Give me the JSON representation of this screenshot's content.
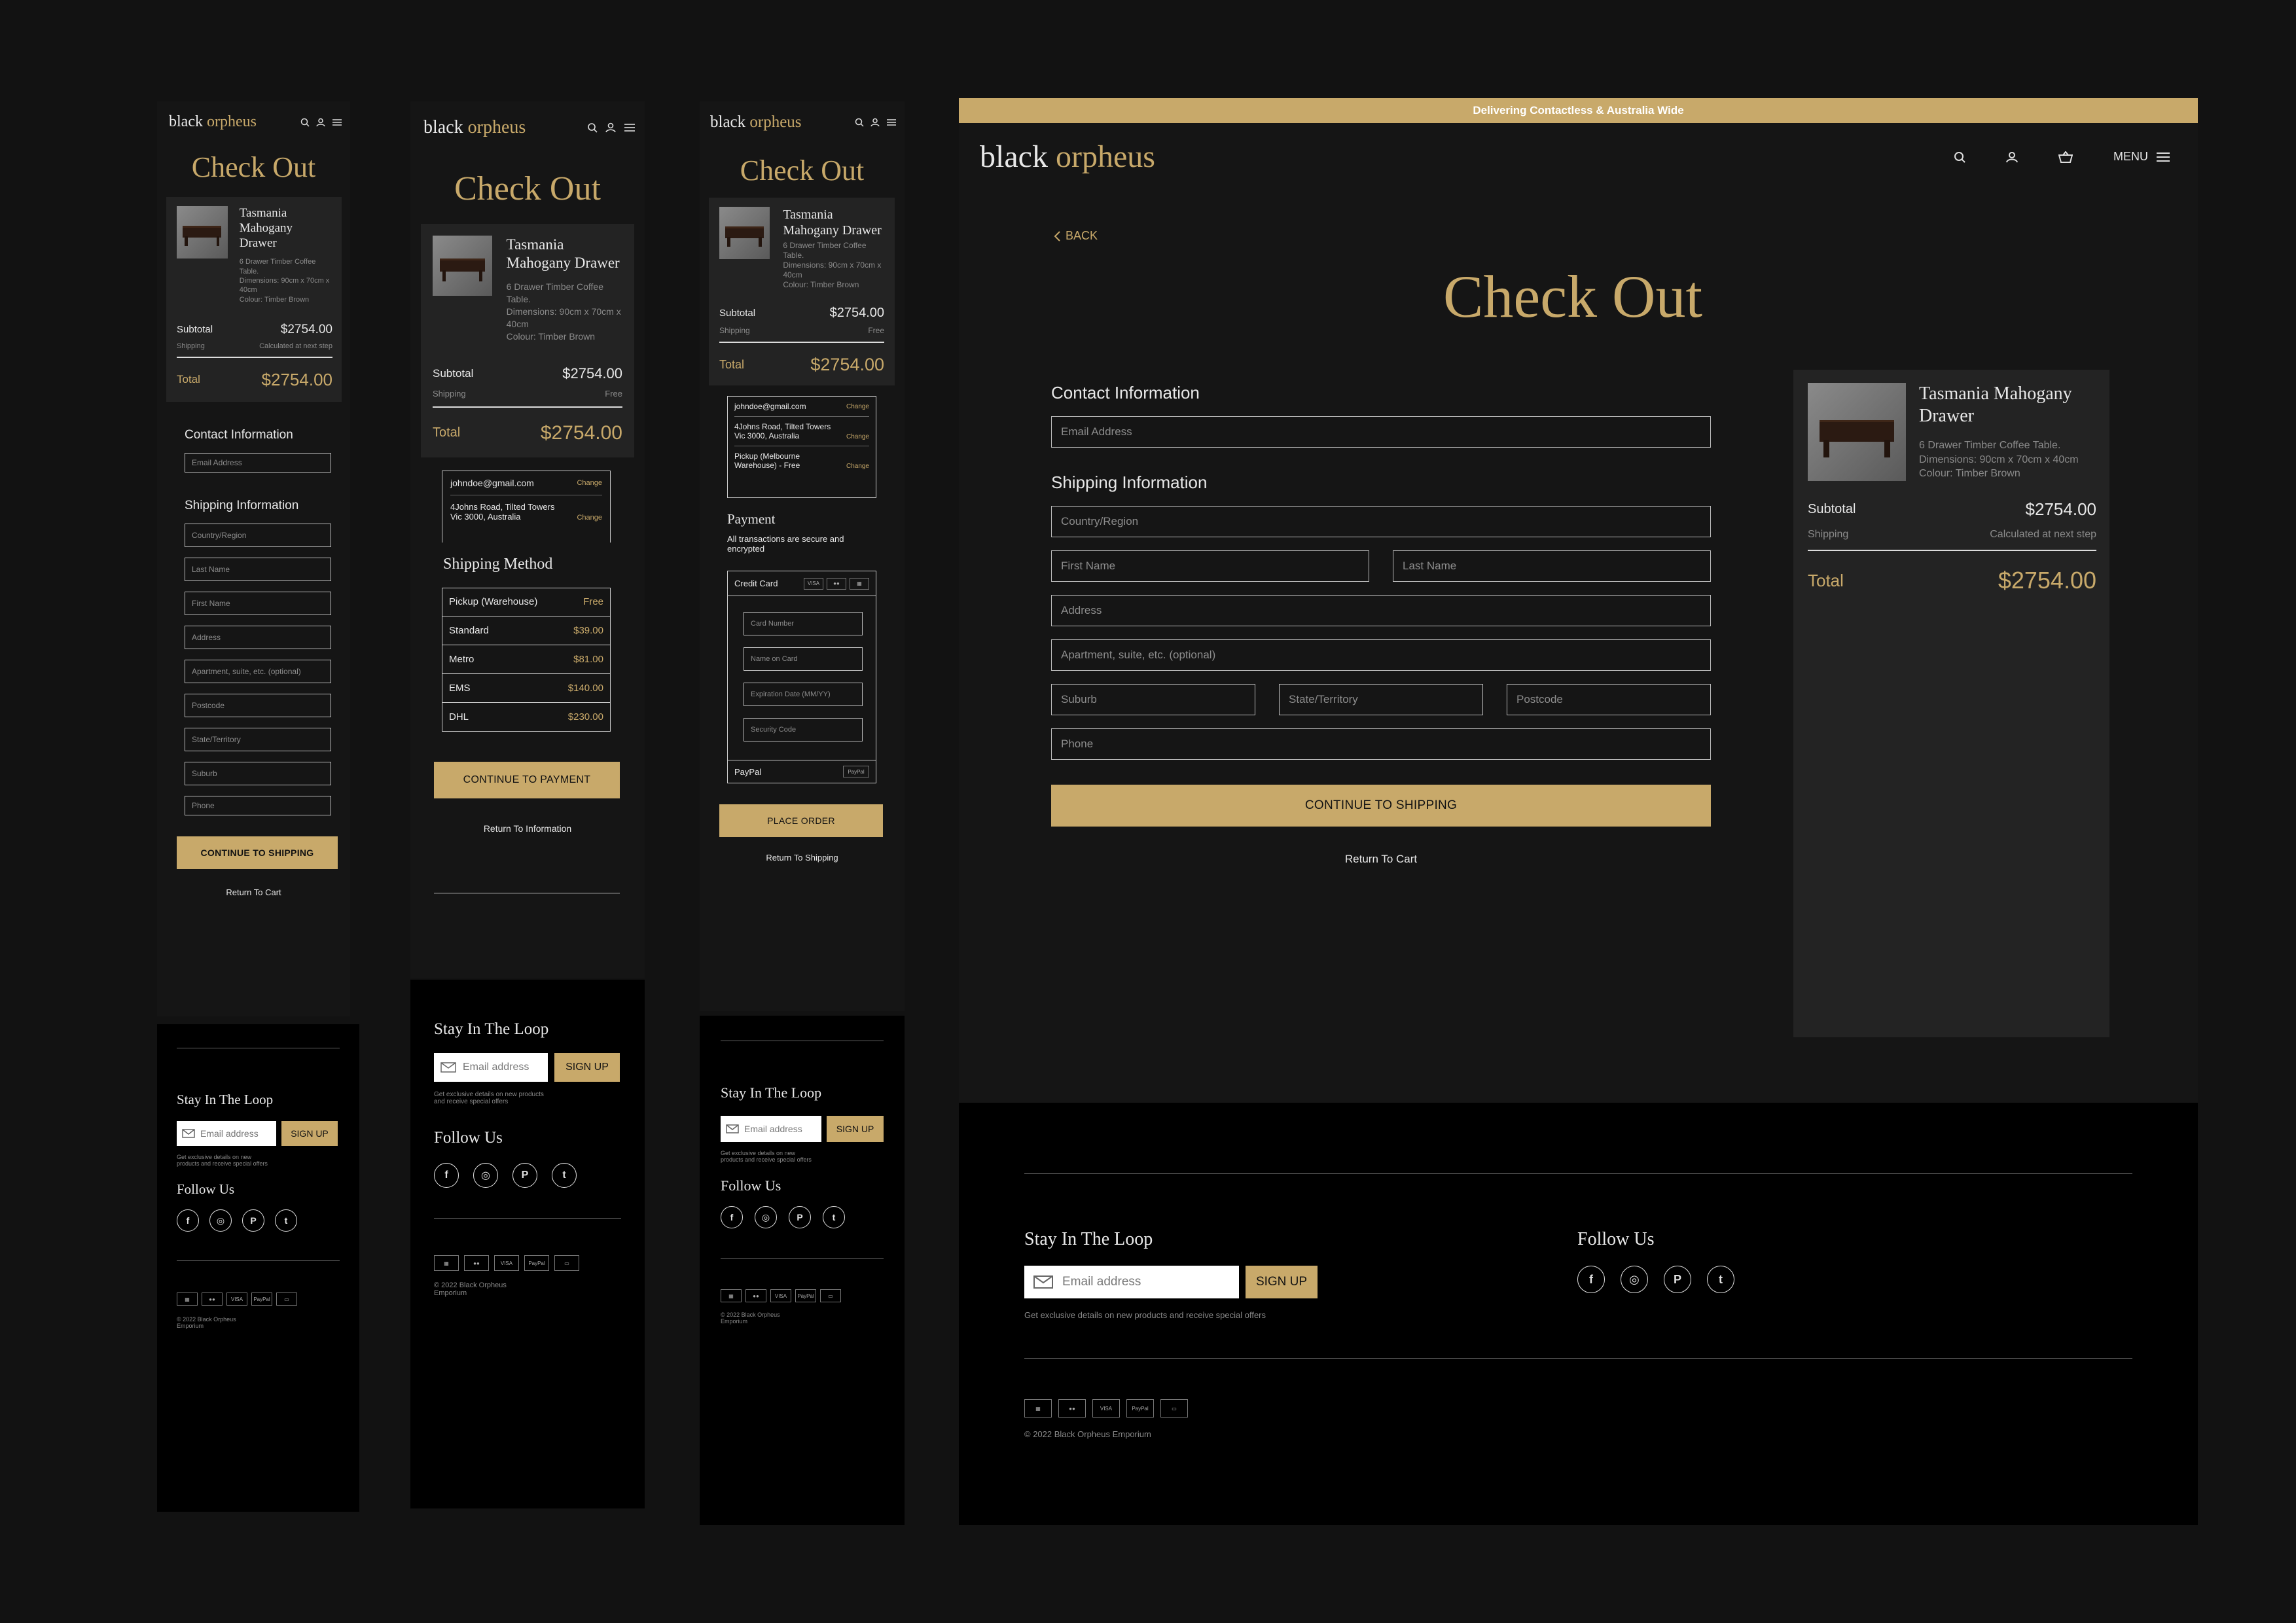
{
  "brand": {
    "word1": "black",
    "word2": "orpheus"
  },
  "banner": "Delivering Contactless & Australia Wide",
  "nav": {
    "menu_label": "MENU",
    "back": "BACK"
  },
  "page_title": "Check Out",
  "product": {
    "name": "Tasmania Mahogany Drawer",
    "description": "6 Drawer Timber Coffee Table.",
    "dimensions": "Dimensions: 90cm x 70cm x 40cm",
    "colour": "Colour: Timber Brown"
  },
  "summary": {
    "subtotal_label": "Subtotal",
    "subtotal_value": "$2754.00",
    "shipping_label": "Shipping",
    "shipping_value_pending": "Calculated at next step",
    "shipping_value_free": "Free",
    "total_label": "Total",
    "total_value": "$2754.00"
  },
  "contact": {
    "heading": "Contact Information",
    "email_placeholder": "Email Address",
    "email_value": "johndoe@gmail.com",
    "change": "Change",
    "address_value": "4Johns Road, Tilted Towers Vic 3000, Australia",
    "pickup_value": "Pickup (Melbourne Warehouse) - Free"
  },
  "shipping_info": {
    "heading": "Shipping Information",
    "country": "Country/Region",
    "first_name": "First Name",
    "last_name": "Last Name",
    "address": "Address",
    "apartment": "Apartment, suite, etc. (optional)",
    "suburb": "Suburb",
    "state": "State/Territory",
    "postcode": "Postcode",
    "phone": "Phone",
    "continue": "CONTINUE TO SHIPPING",
    "return": "Return To Cart"
  },
  "shipping_method": {
    "heading": "Shipping Method",
    "options": [
      {
        "name": "Pickup (Warehouse)",
        "price": "Free"
      },
      {
        "name": "Standard",
        "price": "$39.00"
      },
      {
        "name": "Metro",
        "price": "$81.00"
      },
      {
        "name": "EMS",
        "price": "$140.00"
      },
      {
        "name": "DHL",
        "price": "$230.00"
      }
    ],
    "continue": "CONTINUE TO PAYMENT",
    "return": "Return To Information"
  },
  "payment": {
    "heading": "Payment",
    "note": "All transactions are secure and encrypted",
    "credit_card": "Credit Card",
    "card_number": "Card Number",
    "name_on_card": "Name on Card",
    "expiry": "Expiration Date (MM/YY)",
    "security": "Security Code",
    "paypal": "PayPal",
    "place_order": "PLACE ORDER",
    "return": "Return To Shipping"
  },
  "footer": {
    "loop_heading": "Stay In The Loop",
    "email_placeholder": "Email address",
    "signup": "SIGN UP",
    "note": "Get exclusive details on new products and receive special offers",
    "follow": "Follow Us",
    "copyright": "© 2022 Black Orpheus Emporium",
    "socials": [
      "f",
      "◎",
      "P",
      "t"
    ],
    "cards": [
      "▦",
      "●●",
      "VISA",
      "PayPal",
      "▭"
    ]
  },
  "colors": {
    "accent": "#c8a96a",
    "background": "#121212",
    "panel": "#151515",
    "summary_panel": "#232323"
  }
}
